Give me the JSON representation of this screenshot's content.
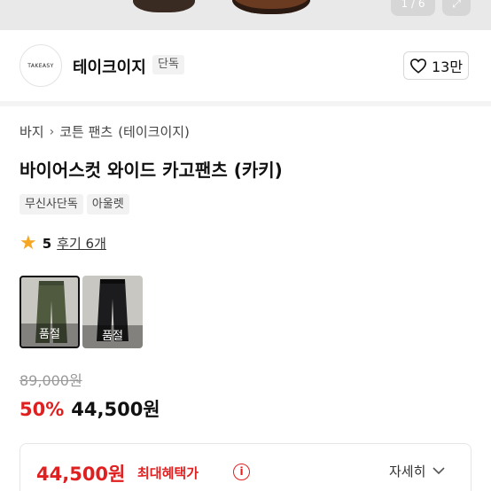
{
  "gallery": {
    "counter": "1 / 6",
    "expand_icon": "expand-icon"
  },
  "brand": {
    "logo_text": "TAKEASY",
    "name": "테이크이지",
    "badge": "단독",
    "like_icon": "heart-icon",
    "like_count": "13만"
  },
  "breadcrumb": {
    "items": [
      "바지",
      "코튼 팬츠",
      "(테이크이지)"
    ],
    "separator_icon": "chevron-right-icon"
  },
  "product": {
    "title": "바이어스컷 와이드 카고팬츠 (카키)",
    "tags": [
      "무신사단독",
      "아울렛"
    ],
    "rating": {
      "star_icon": "star-icon",
      "score": "5",
      "reviews": "후기 6개"
    },
    "options": [
      {
        "label": "품절",
        "color": "#4f5a3f",
        "selected": true
      },
      {
        "label": "품절",
        "color": "#1c1c1e",
        "selected": false
      }
    ]
  },
  "price": {
    "original": "89,000원",
    "discount": "50%",
    "sale": "44,500원"
  },
  "benefit": {
    "price": "44,500원",
    "label": "최대혜택가",
    "info_icon": "info-icon",
    "detail_label": "자세히",
    "detail_icon": "chevron-down-icon"
  },
  "colors": {
    "accent_red": "#e02020",
    "star": "#f5a623"
  }
}
